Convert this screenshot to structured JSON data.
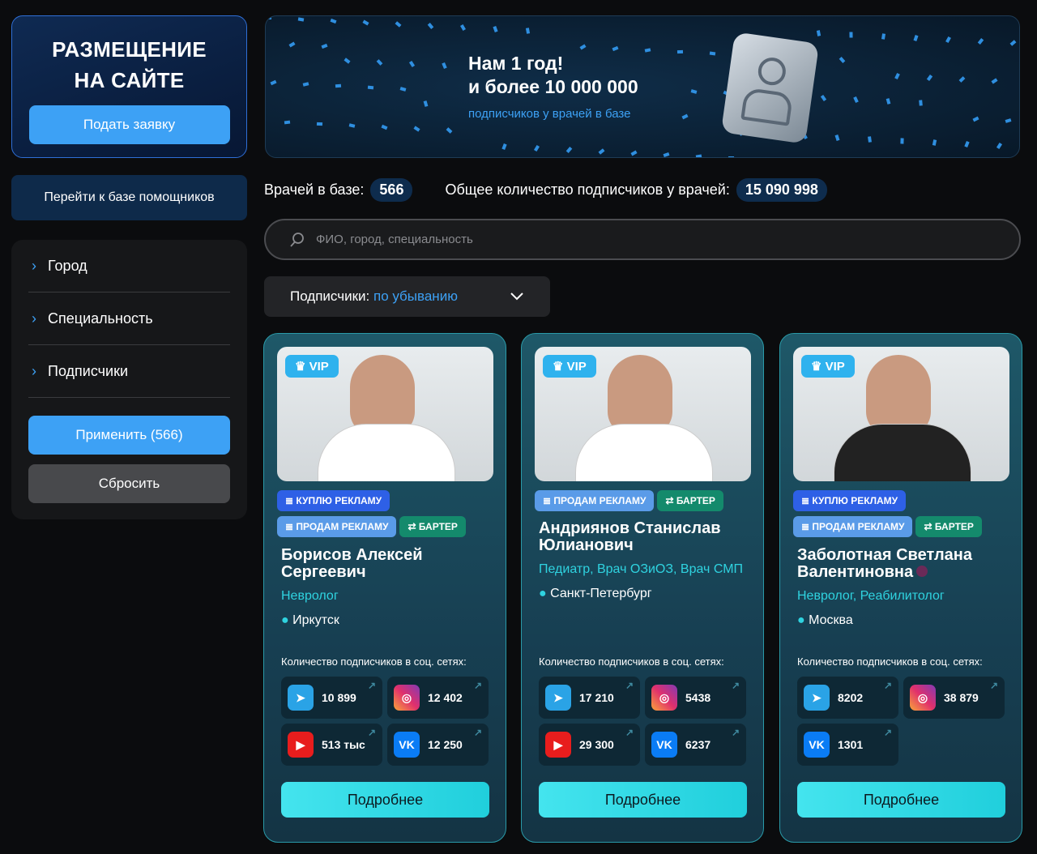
{
  "promo": {
    "title_line1": "РАЗМЕЩЕНИЕ",
    "title_line2": "НА САЙТЕ",
    "button": "Подать заявку"
  },
  "assistants_button": "Перейти к базе помощников",
  "filters": {
    "items": [
      "Город",
      "Специальность",
      "Подписчики"
    ],
    "apply": "Применить (566)",
    "reset": "Сбросить"
  },
  "banner": {
    "line1": "Нам 1 год!",
    "line2": "и более 10 000 000",
    "line3": "подписчиков у врачей в базе"
  },
  "stats": {
    "doctors_label": "Врачей в базе:",
    "doctors_count": "566",
    "subs_label": "Общее количество подписчиков у врачей:",
    "subs_count": "15 090 998"
  },
  "search": {
    "placeholder": "ФИО, город, специальность"
  },
  "sort": {
    "label": "Подписчики:",
    "value": "по убыванию"
  },
  "subs_caption": "Количество подписчиков в соц. сетях:",
  "more_label": "Подробнее",
  "vip_label": "VIP",
  "cards": [
    {
      "tags": [
        [
          "buy",
          "КУПЛЮ РЕКЛАМУ"
        ],
        [
          "sell",
          "ПРОДАМ РЕКЛАМУ"
        ],
        [
          "barter",
          "БАРТЕР"
        ]
      ],
      "name": "Борисов Алексей Сергеевич",
      "spec": "Невролог",
      "city": "Иркутск",
      "social": [
        [
          "telegram",
          "10 899"
        ],
        [
          "instagram",
          "12 402"
        ],
        [
          "youtube",
          "513 тыс"
        ],
        [
          "vk",
          "12 250"
        ]
      ]
    },
    {
      "tags": [
        [
          "sell",
          "ПРОДАМ РЕКЛАМУ"
        ],
        [
          "barter",
          "БАРТЕР"
        ]
      ],
      "name": "Андриянов Станислав Юлианович",
      "spec": "Педиатр, Врач ОЗиОЗ, Врач СМП",
      "city": "Санкт-Петербург",
      "social": [
        [
          "telegram",
          "17 210"
        ],
        [
          "instagram",
          "5438"
        ],
        [
          "youtube",
          "29 300"
        ],
        [
          "vk",
          "6237"
        ]
      ]
    },
    {
      "tags": [
        [
          "buy",
          "КУПЛЮ РЕКЛАМУ"
        ],
        [
          "sell",
          "ПРОДАМ РЕКЛАМУ"
        ],
        [
          "barter",
          "БАРТЕР"
        ]
      ],
      "name": "Заболотная Светлана Валентиновна",
      "spec": "Невролог, Реабилитолог",
      "city": "Москва",
      "social": [
        [
          "telegram",
          "8202"
        ],
        [
          "instagram",
          "38 879"
        ],
        [
          "vk",
          "1301"
        ]
      ]
    }
  ]
}
